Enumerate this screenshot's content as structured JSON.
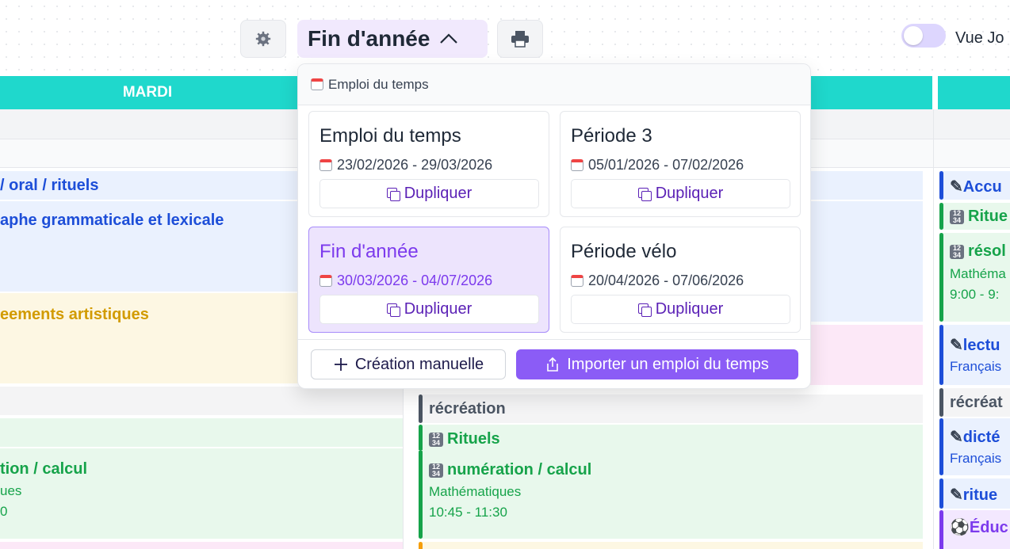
{
  "toolbar": {
    "settings_icon": "gear-icon",
    "period_label": "Fin d'année",
    "print_icon": "printer-icon",
    "toggle_label": "Vue Jo"
  },
  "grid": {
    "days": [
      "MARDI"
    ],
    "events": {
      "col1": {
        "e1": "/ oral / rituels",
        "e2": "aphe grammaticale et lexicale",
        "e3": "eements artistiques",
        "e4": "tion / calcul",
        "e4_sub1": "ues",
        "e4_sub2": "0"
      },
      "col2": {
        "e1": "récréation",
        "e2": "Rituels",
        "e3": "numération / calcul",
        "e3_sub1": "Mathématiques",
        "e3_sub2": "10:45 - 11:30"
      },
      "col3": {
        "e1": "Accu",
        "e2": "Ritue",
        "e3": "résol",
        "e3_sub1": "Mathéma",
        "e3_sub2": "9:00 - 9:",
        "e4": "lectu",
        "e4_sub1": "Français",
        "e5": "récréat",
        "e6": "dicté",
        "e6_sub1": "Français",
        "e7": "ritue",
        "e8": "Éduc"
      }
    }
  },
  "dropdown": {
    "header": "Emploi du temps",
    "cards": [
      {
        "name": "Emploi du temps",
        "dates": "23/02/2026 - 29/03/2026",
        "action": "Dupliquer"
      },
      {
        "name": "Période 3",
        "dates": "05/01/2026 - 07/02/2026",
        "action": "Dupliquer"
      },
      {
        "name": "Fin d'année",
        "dates": "30/03/2026 - 04/07/2026",
        "action": "Dupliquer"
      },
      {
        "name": "Période vélo",
        "dates": "20/04/2026 - 07/06/2026",
        "action": "Dupliquer"
      }
    ],
    "manual_label": "Création manuelle",
    "import_label": "Importer un emploi du temps"
  },
  "colors": {
    "header_teal": "#1fd8cc",
    "accent_purple": "#8b5cf6",
    "selected_bg": "#ede4fd"
  }
}
